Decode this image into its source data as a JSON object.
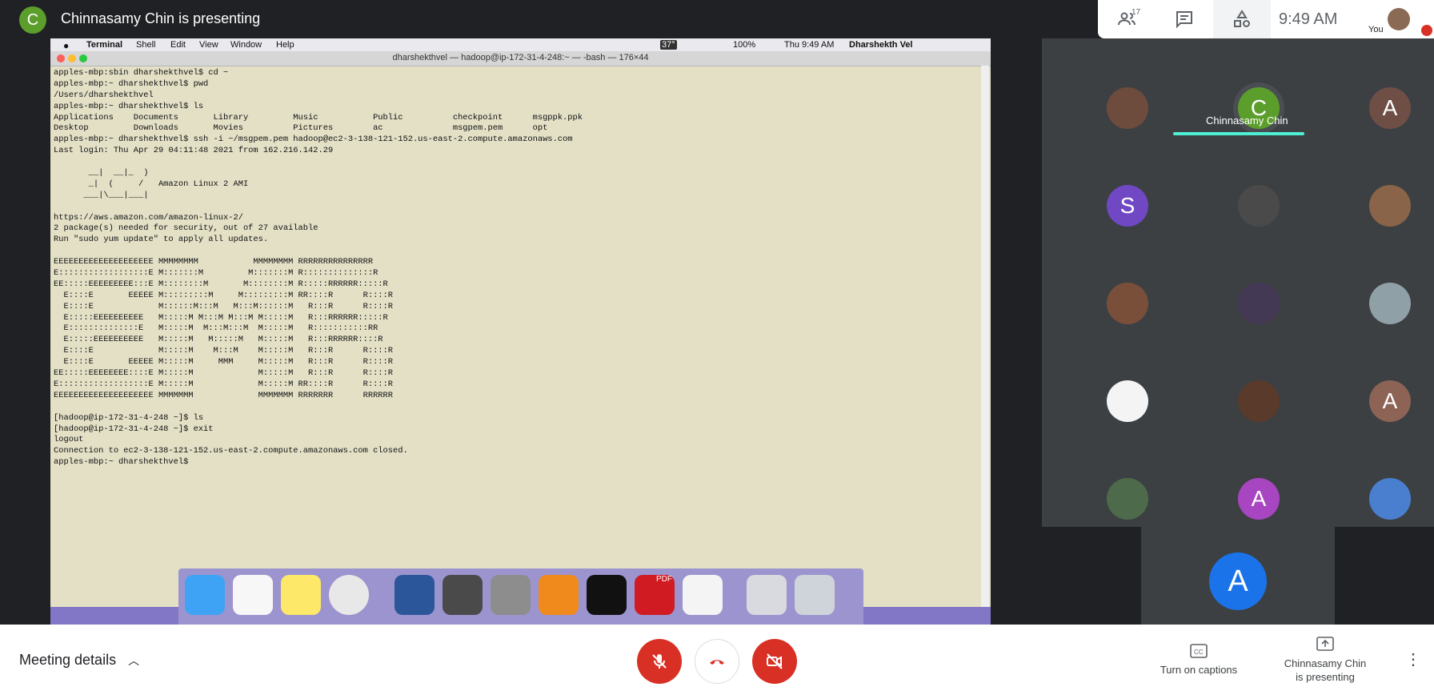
{
  "presenter": {
    "initial": "C",
    "title": "Chinnasamy Chin is presenting"
  },
  "top_panel": {
    "participant_count": "17",
    "time": "9:49 AM",
    "self_label": "You"
  },
  "mac_menubar": {
    "items": [
      "Terminal",
      "Shell",
      "Edit",
      "View",
      "Window",
      "Help"
    ],
    "status": {
      "temp": "37°",
      "battery": "100%",
      "datetime": "Thu 9:49 AM",
      "user": "Dharshekth Vel"
    }
  },
  "terminal": {
    "title": "dharshekthvel — hadoop@ip-172-31-4-248:~ — -bash — 176×44",
    "lines": [
      "apples-mbp:sbin dharshekthvel$ cd ~",
      "apples-mbp:~ dharshekthvel$ pwd",
      "/Users/dharshekthvel",
      "apples-mbp:~ dharshekthvel$ ls",
      "Applications    Documents       Library         Music           Public          checkpoint      msgppk.ppk",
      "Desktop         Downloads       Movies          Pictures        ac              msgpem.pem      opt",
      "apples-mbp:~ dharshekthvel$ ssh -i ~/msgpem.pem hadoop@ec2-3-138-121-152.us-east-2.compute.amazonaws.com",
      "Last login: Thu Apr 29 04:11:48 2021 from 162.216.142.29",
      "",
      "       __|  __|_  )",
      "       _|  (     /   Amazon Linux 2 AMI",
      "      ___|\\___|___|",
      "",
      "https://aws.amazon.com/amazon-linux-2/",
      "2 package(s) needed for security, out of 27 available",
      "Run \"sudo yum update\" to apply all updates.",
      "",
      "EEEEEEEEEEEEEEEEEEEE MMMMMMMM           MMMMMMMM RRRRRRRRRRRRRRR",
      "E::::::::::::::::::E M:::::::M         M:::::::M R::::::::::::::R",
      "EE:::::EEEEEEEEE:::E M::::::::M       M::::::::M R:::::RRRRRR:::::R",
      "  E::::E       EEEEE M:::::::::M     M:::::::::M RR::::R      R::::R",
      "  E::::E             M::::::M:::M   M:::M::::::M   R:::R      R::::R",
      "  E:::::EEEEEEEEEE   M:::::M M:::M M:::M M:::::M   R:::RRRRRR:::::R",
      "  E::::::::::::::E   M:::::M  M:::M:::M  M:::::M   R:::::::::::RR",
      "  E:::::EEEEEEEEEE   M:::::M   M:::::M   M:::::M   R:::RRRRRR::::R",
      "  E::::E             M:::::M    M:::M    M:::::M   R:::R      R::::R",
      "  E::::E       EEEEE M:::::M     MMM     M:::::M   R:::R      R::::R",
      "EE:::::EEEEEEEE::::E M:::::M             M:::::M   R:::R      R::::R",
      "E::::::::::::::::::E M:::::M             M:::::M RR::::R      R::::R",
      "EEEEEEEEEEEEEEEEEEEE MMMMMMM             MMMMMMM RRRRRRR      RRRRRR",
      "",
      "[hadoop@ip-172-31-4-248 ~]$ ls",
      "[hadoop@ip-172-31-4-248 ~]$ exit",
      "logout",
      "Connection to ec2-3-138-121-152.us-east-2.compute.amazonaws.com closed.",
      "apples-mbp:~ dharshekthvel$ "
    ]
  },
  "dock": {
    "pdf_badge": "PDF"
  },
  "participants": {
    "active_speaker": {
      "initial": "C",
      "name": "Chinnasamy Chin"
    },
    "tiles": [
      {
        "initial": ""
      },
      {
        "initial": "A"
      },
      {
        "initial": "S"
      },
      {
        "initial": ""
      },
      {
        "initial": ""
      },
      {
        "initial": ""
      },
      {
        "initial": ""
      },
      {
        "initial": ""
      },
      {
        "initial": ""
      },
      {
        "initial": ""
      },
      {
        "initial": "A"
      },
      {
        "initial": ""
      },
      {
        "initial": "A"
      },
      {
        "initial": ""
      }
    ],
    "self_initial": "A"
  },
  "bottom_bar": {
    "meeting_details": "Meeting details",
    "captions": "Turn on captions",
    "presenting_line1": "Chinnasamy Chin",
    "presenting_line2": "is presenting"
  },
  "colors": {
    "end_call": "#d93025",
    "accent": "#4ef0d4",
    "terminal_bg": "#e3e0c6"
  }
}
